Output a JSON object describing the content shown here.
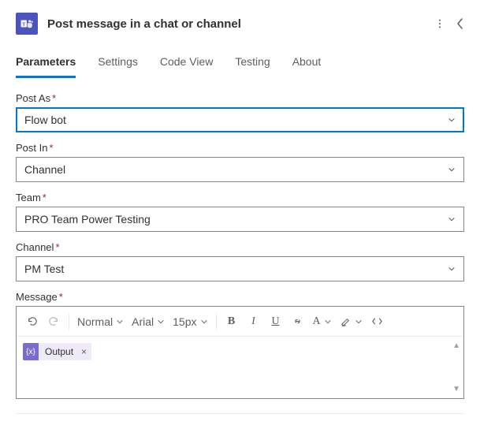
{
  "header": {
    "title": "Post message in a chat or channel"
  },
  "tabs": {
    "items": [
      {
        "label": "Parameters"
      },
      {
        "label": "Settings"
      },
      {
        "label": "Code View"
      },
      {
        "label": "Testing"
      },
      {
        "label": "About"
      }
    ]
  },
  "fields": {
    "post_as": {
      "label": "Post As",
      "value": "Flow bot"
    },
    "post_in": {
      "label": "Post In",
      "value": "Channel"
    },
    "team": {
      "label": "Team",
      "value": "PRO Team Power Testing"
    },
    "channel": {
      "label": "Channel",
      "value": "PM Test"
    },
    "message": {
      "label": "Message"
    }
  },
  "rte": {
    "style": "Normal",
    "font": "Arial",
    "size": "15px",
    "token": "Output"
  }
}
